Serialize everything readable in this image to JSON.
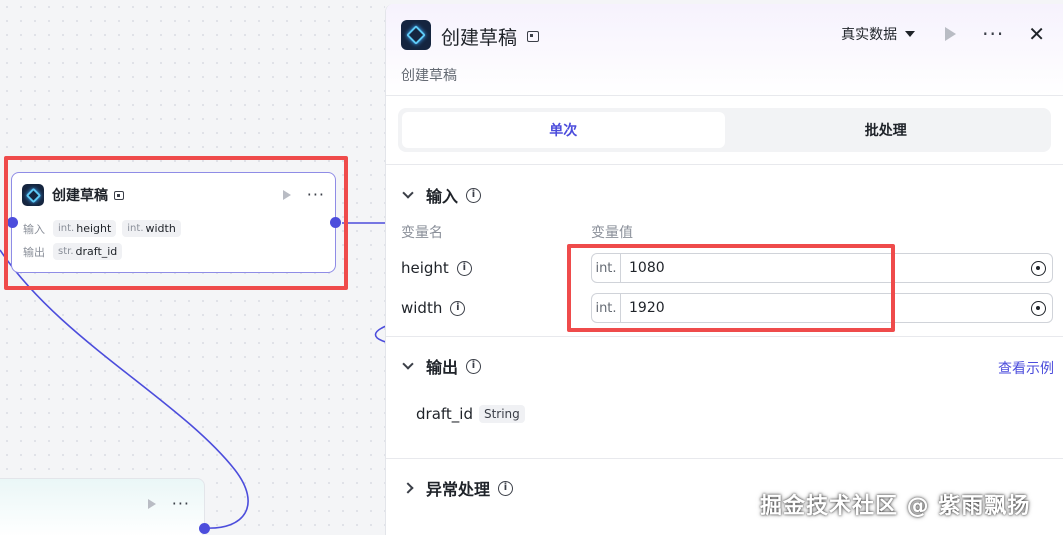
{
  "node": {
    "title": "创建草稿",
    "input_label": "输入",
    "output_label": "输出",
    "inputs": [
      {
        "type": "int.",
        "name": "height"
      },
      {
        "type": "int.",
        "name": "width"
      }
    ],
    "outputs": [
      {
        "type": "str.",
        "name": "draft_id"
      }
    ]
  },
  "panel": {
    "title": "创建草稿",
    "subtitle": "创建草稿",
    "data_mode": "真实数据",
    "tabs": [
      {
        "label": "单次",
        "active": true
      },
      {
        "label": "批处理",
        "active": false
      }
    ],
    "input_section": {
      "title": "输入",
      "col_name": "变量名",
      "col_value": "变量值",
      "rows": [
        {
          "name": "height",
          "type": "int.",
          "value": "1080"
        },
        {
          "name": "width",
          "type": "int.",
          "value": "1920"
        }
      ]
    },
    "output_section": {
      "title": "输出",
      "view_example": "查看示例",
      "item_name": "draft_id",
      "item_type": "String"
    },
    "error_section": {
      "title": "异常处理"
    }
  },
  "watermark": "掘金技术社区 @ 紫雨飘扬",
  "colors": {
    "accent": "#4c4ddc",
    "highlight": "#ef4b4b"
  }
}
